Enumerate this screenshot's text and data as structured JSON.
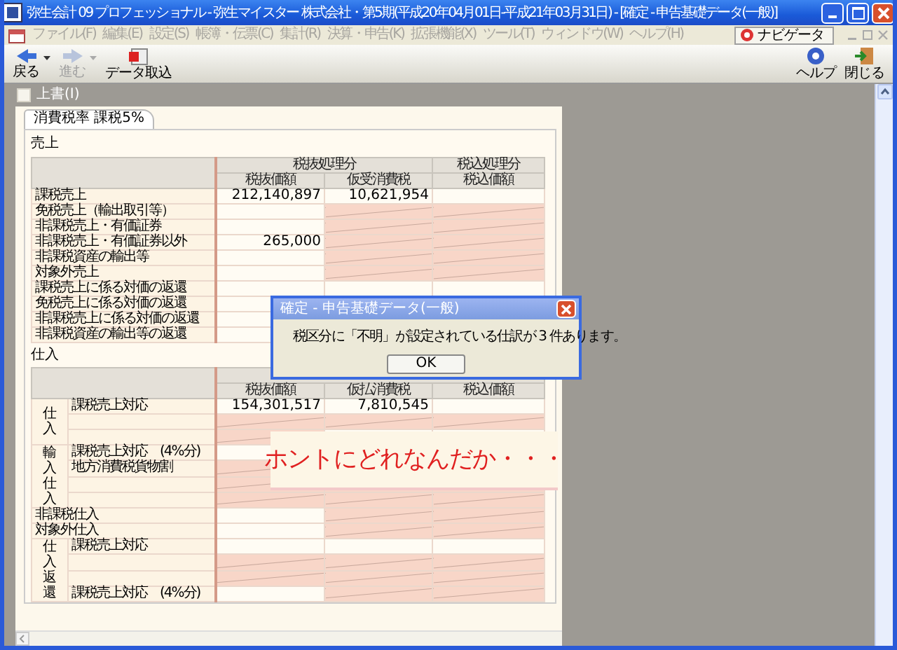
{
  "window": {
    "title": "弥生会計 09 プロフェッショナル - 弥生マイスター 株式会社・第5期(平成20年04月01日-平成21年03月31日) - [確定 - 申告基礎データ(一般)]"
  },
  "menu": [
    {
      "label": "ファイル(F)",
      "disabled": true
    },
    {
      "label": "編集(E)",
      "disabled": true
    },
    {
      "label": "設定(S)",
      "disabled": true
    },
    {
      "label": "帳簿・伝票(C)",
      "disabled": true
    },
    {
      "label": "集計(R)",
      "disabled": true
    },
    {
      "label": "決算・申告(K)",
      "disabled": true
    },
    {
      "label": "拡張機能(X)",
      "disabled": true
    },
    {
      "label": "ツール(T)",
      "disabled": true
    },
    {
      "label": "ウィンドウ(W)",
      "disabled": true
    },
    {
      "label": "ヘルプ(H)",
      "disabled": true
    }
  ],
  "navigator_button": "ナビゲータ",
  "toolbar_left": [
    {
      "kind": "back",
      "label": "戻る",
      "disabled": false
    },
    {
      "kind": "forward",
      "label": "進む",
      "disabled": true
    },
    {
      "kind": "import",
      "label": "データ取込",
      "disabled": false
    }
  ],
  "toolbar_right": [
    {
      "kind": "help",
      "label": "ヘルプ"
    },
    {
      "kind": "close",
      "label": "閉じる"
    }
  ],
  "overwrite": {
    "label": "上書(I)",
    "checked": false
  },
  "tab": "消費税率  課税5%",
  "sales": {
    "label": "売上",
    "header_top": [
      "税抜処理分",
      "税込処理分"
    ],
    "header_sub": [
      "税抜価額",
      "仮受消費税",
      "税込価額"
    ],
    "rows": [
      {
        "label": "課税売上",
        "cells": [
          {
            "value": "212,140,897",
            "disabled": false
          },
          {
            "value": "10,621,954",
            "disabled": false
          },
          {
            "disabled": false
          }
        ]
      },
      {
        "label": "免税売上（輸出取引等）",
        "cells": [
          {
            "disabled": false
          },
          {
            "disabled": true
          },
          {
            "disabled": true
          }
        ]
      },
      {
        "label": "非課税売上・有価証券",
        "cells": [
          {
            "disabled": false
          },
          {
            "disabled": true
          },
          {
            "disabled": true
          }
        ]
      },
      {
        "label": "非課税売上・有価証券以外",
        "cells": [
          {
            "value": "265,000",
            "disabled": false
          },
          {
            "disabled": true
          },
          {
            "disabled": true
          }
        ]
      },
      {
        "label": "非課税資産の輸出等",
        "cells": [
          {
            "disabled": false
          },
          {
            "disabled": true
          },
          {
            "disabled": true
          }
        ]
      },
      {
        "label": "対象外売上",
        "cells": [
          {
            "disabled": false
          },
          {
            "disabled": true
          },
          {
            "disabled": true
          }
        ]
      },
      {
        "label": "課税売上に係る対価の返還",
        "cells": [
          {
            "disabled": false
          },
          {
            "disabled": false
          },
          {
            "disabled": false
          }
        ]
      },
      {
        "label": "免税売上に係る対価の返還",
        "cells": [
          {
            "disabled": false
          },
          {},
          {}
        ]
      },
      {
        "label": "非課税売上に係る対価の返還",
        "cells": [
          {
            "disabled": false
          },
          {},
          {}
        ]
      },
      {
        "label": "非課税資産の輸出等の返還",
        "cells": [
          {
            "disabled": false
          },
          {},
          {}
        ]
      }
    ]
  },
  "purchases": {
    "label": "仕入",
    "header_sub": [
      "税抜価額",
      "仮払消費税",
      "税込価額"
    ],
    "rows": [
      {
        "kind": "group",
        "label": "仕入",
        "rows": [
          {
            "label": "課税売上対応",
            "cells": [
              {
                "value": "154,301,517",
                "disabled": false
              },
              {
                "value": "7,810,545",
                "disabled": false
              },
              {
                "disabled": false
              }
            ]
          },
          {
            "cells": [
              {
                "disabled": true
              },
              {
                "disabled": true
              },
              {
                "disabled": true
              }
            ]
          },
          {
            "cells": [
              {
                "disabled": true
              },
              {},
              {}
            ]
          }
        ]
      },
      {
        "kind": "group",
        "label": "輸入仕入",
        "rows": [
          {
            "label": "課税売上対応　(4%分)",
            "cells": [
              {
                "disabled": false
              },
              {},
              {}
            ]
          },
          {
            "label": "地方消費税貨物割",
            "cells": [
              {
                "disabled": true
              },
              {},
              {}
            ]
          },
          {
            "cells": [
              {
                "disabled": true
              },
              {
                "disabled": true
              },
              {
                "disabled": true
              }
            ]
          },
          {
            "cells": [
              {
                "disabled": true
              },
              {
                "disabled": true
              },
              {
                "disabled": true
              }
            ]
          }
        ]
      },
      {
        "kind": "single",
        "label": "非課税仕入",
        "cells": [
          {
            "disabled": false
          },
          {
            "disabled": true
          },
          {
            "disabled": true
          }
        ]
      },
      {
        "kind": "single",
        "label": "対象外仕入",
        "cells": [
          {
            "disabled": false
          },
          {
            "disabled": true
          },
          {
            "disabled": true
          }
        ]
      },
      {
        "kind": "group",
        "label": "仕入返還",
        "rows": [
          {
            "label": "課税売上対応",
            "cells": [
              {
                "disabled": false
              },
              {
                "disabled": false
              },
              {
                "disabled": false
              }
            ]
          },
          {
            "cells": [
              {
                "disabled": true
              },
              {
                "disabled": true
              },
              {
                "disabled": true
              }
            ]
          },
          {
            "cells": [
              {
                "disabled": true
              },
              {
                "disabled": true
              },
              {
                "disabled": true
              }
            ]
          },
          {
            "label": "課税売上対応　(4%分)",
            "cells": [
              {
                "disabled": false
              },
              {
                "disabled": true
              },
              {
                "disabled": true
              }
            ]
          }
        ]
      }
    ]
  },
  "dialog": {
    "title": "確定 - 申告基礎データ(一般)",
    "message": "税区分に「不明」が設定されている仕訳が 3 件あります。",
    "button": "OK"
  },
  "callout": "ホントにどれなんだか・・・"
}
